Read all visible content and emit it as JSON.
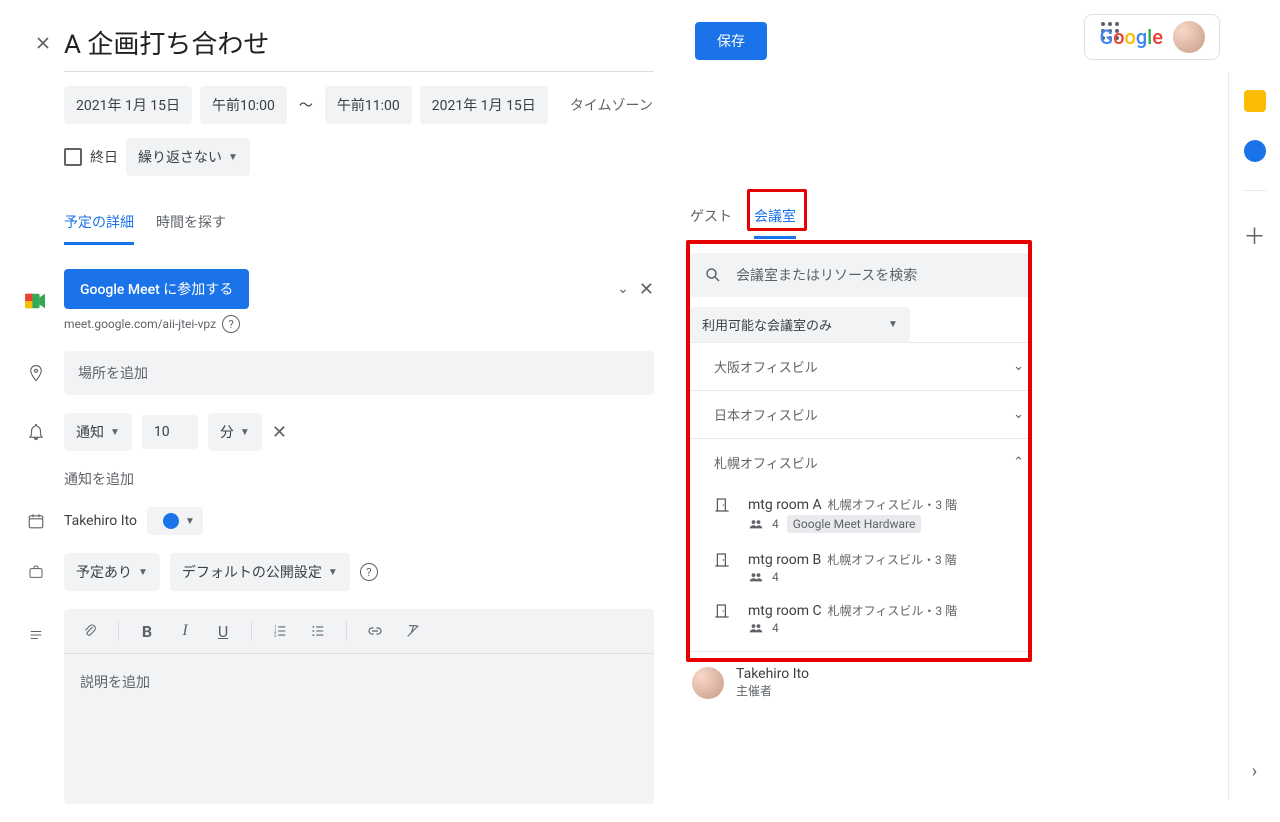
{
  "header": {
    "title": "A 企画打ち合わせ",
    "save": "保存"
  },
  "datetime": {
    "start_date": "2021年 1月 15日",
    "start_time": "午前10:00",
    "end_time": "午前11:00",
    "end_date": "2021年 1月 15日",
    "timezone": "タイムゾーン",
    "all_day": "終日",
    "recurrence": "繰り返さない"
  },
  "tabs": {
    "details": "予定の詳細",
    "find_time": "時間を探す"
  },
  "meet": {
    "button": "Google Meet に参加する",
    "link": "meet.google.com/aii-jtei-vpz"
  },
  "location": {
    "placeholder": "場所を追加"
  },
  "notification": {
    "type": "通知",
    "value": "10",
    "unit": "分",
    "add": "通知を追加"
  },
  "calendar_owner": "Takehiro Ito",
  "visibility": {
    "busy": "予定あり",
    "default": "デフォルトの公開設定"
  },
  "description": {
    "placeholder": "説明を追加"
  },
  "right_tabs": {
    "guests": "ゲスト",
    "rooms": "会議室"
  },
  "room_search": {
    "placeholder": "会議室またはリソースを検索"
  },
  "room_filter": "利用可能な会議室のみ",
  "buildings": {
    "osaka": "大阪オフィスビル",
    "japan": "日本オフィスビル",
    "sapporo": "札幌オフィスビル"
  },
  "rooms": [
    {
      "name": "mtg room A",
      "loc": "札幌オフィスビル・3 階",
      "cap": "4",
      "hw": "Google Meet Hardware"
    },
    {
      "name": "mtg room B",
      "loc": "札幌オフィスビル・3 階",
      "cap": "4"
    },
    {
      "name": "mtg room C",
      "loc": "札幌オフィスビル・3 階",
      "cap": "4"
    }
  ],
  "organizer": {
    "name": "Takehiro Ito",
    "role": "主催者"
  }
}
